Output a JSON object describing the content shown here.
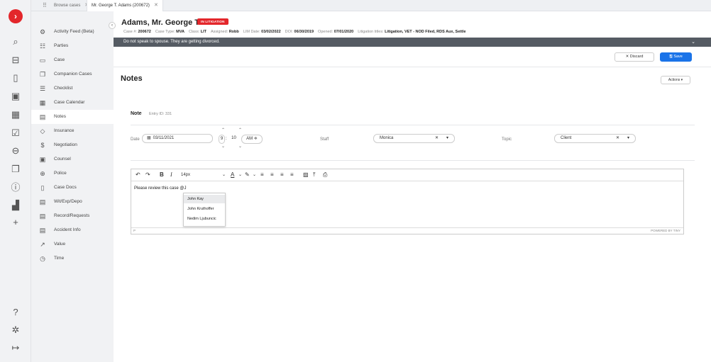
{
  "tabs": [
    {
      "label": "Browse cases",
      "close": "✕"
    },
    {
      "label": "Mr. George T. Adams (200672)",
      "close": "✕"
    }
  ],
  "rail": {
    "logo": "›",
    "icons": [
      "search-icon",
      "briefcase-icon",
      "document-icon",
      "contact-card-icon",
      "calendar-icon",
      "checklist-icon",
      "inbox-icon",
      "copy-icon",
      "info-icon",
      "stats-icon",
      "add-icon",
      "help-icon",
      "settings-icon",
      "logout-icon"
    ]
  },
  "sidebar": {
    "items": [
      {
        "label": "Activity Feed (Beta)",
        "icon": "activity-icon",
        "glyph": "⚙"
      },
      {
        "label": "Parties",
        "icon": "people-icon",
        "glyph": "☷"
      },
      {
        "label": "Case",
        "icon": "folder-icon",
        "glyph": "▭"
      },
      {
        "label": "Companion Cases",
        "icon": "copy-icon",
        "glyph": "❐"
      },
      {
        "label": "Checklist",
        "icon": "checklist-icon",
        "glyph": "☰"
      },
      {
        "label": "Case Calendar",
        "icon": "calendar-icon",
        "glyph": "▦"
      },
      {
        "label": "Notes",
        "icon": "notes-icon",
        "glyph": "▤"
      },
      {
        "label": "Insurance",
        "icon": "shield-icon",
        "glyph": "◇"
      },
      {
        "label": "Negotiation",
        "icon": "dollar-icon",
        "glyph": "$"
      },
      {
        "label": "Counsel",
        "icon": "message-icon",
        "glyph": "▣"
      },
      {
        "label": "Police",
        "icon": "badge-icon",
        "glyph": "⊕"
      },
      {
        "label": "Case Docs",
        "icon": "file-icon",
        "glyph": "▯"
      },
      {
        "label": "Wit/Exp/Depo",
        "icon": "list-icon",
        "glyph": "▤"
      },
      {
        "label": "Record/Requests",
        "icon": "list-icon",
        "glyph": "▤"
      },
      {
        "label": "Accident Info",
        "icon": "list-icon",
        "glyph": "▤"
      },
      {
        "label": "Value",
        "icon": "trend-icon",
        "glyph": "↗"
      },
      {
        "label": "Time",
        "icon": "clock-icon",
        "glyph": "◷"
      }
    ],
    "active_index": 6
  },
  "case": {
    "title": "Adams, Mr. George T.",
    "badge": "IN LITIGATION",
    "meta": [
      {
        "k": "Case #:",
        "v": "200672"
      },
      {
        "k": "Case Type:",
        "v": "MVA"
      },
      {
        "k": "Class:",
        "v": "LIT"
      },
      {
        "k": "Assigned:",
        "v": "Robb"
      },
      {
        "k": "LIM Date:",
        "v": "03/02/2022"
      },
      {
        "k": "DOI:",
        "v": "06/30/2019"
      },
      {
        "k": "Opened:",
        "v": "07/01/2020"
      },
      {
        "k": "Litigation titles:",
        "v": "Litigation, VET - NOD Filed, RDS Aux, Settle"
      }
    ],
    "alert": "Do not speak to spouse. They are getting divorced."
  },
  "buttons": {
    "discard": "✕  Discard",
    "save": "🖫  Save",
    "actions": "Actions  ▾"
  },
  "page": {
    "title": "Notes"
  },
  "note": {
    "label": "Note",
    "entry_id": "Entry ID: 331",
    "date_label": "Date",
    "date_value": "03/11/2021",
    "hour": "9",
    "minute": "10",
    "ampm": "AM ≑",
    "staff_label": "Staff",
    "staff_value": "Monica",
    "topic_label": "Topic",
    "topic_value": "Client"
  },
  "editor": {
    "font_size": "14px",
    "content": "Please review this case @J",
    "status_path": "P",
    "powered": "POWERED BY TINY"
  },
  "mention": {
    "options": [
      "John Kay",
      "John Kruthoffer",
      "Nedim Ljubuncic"
    ],
    "highlighted": 0
  }
}
